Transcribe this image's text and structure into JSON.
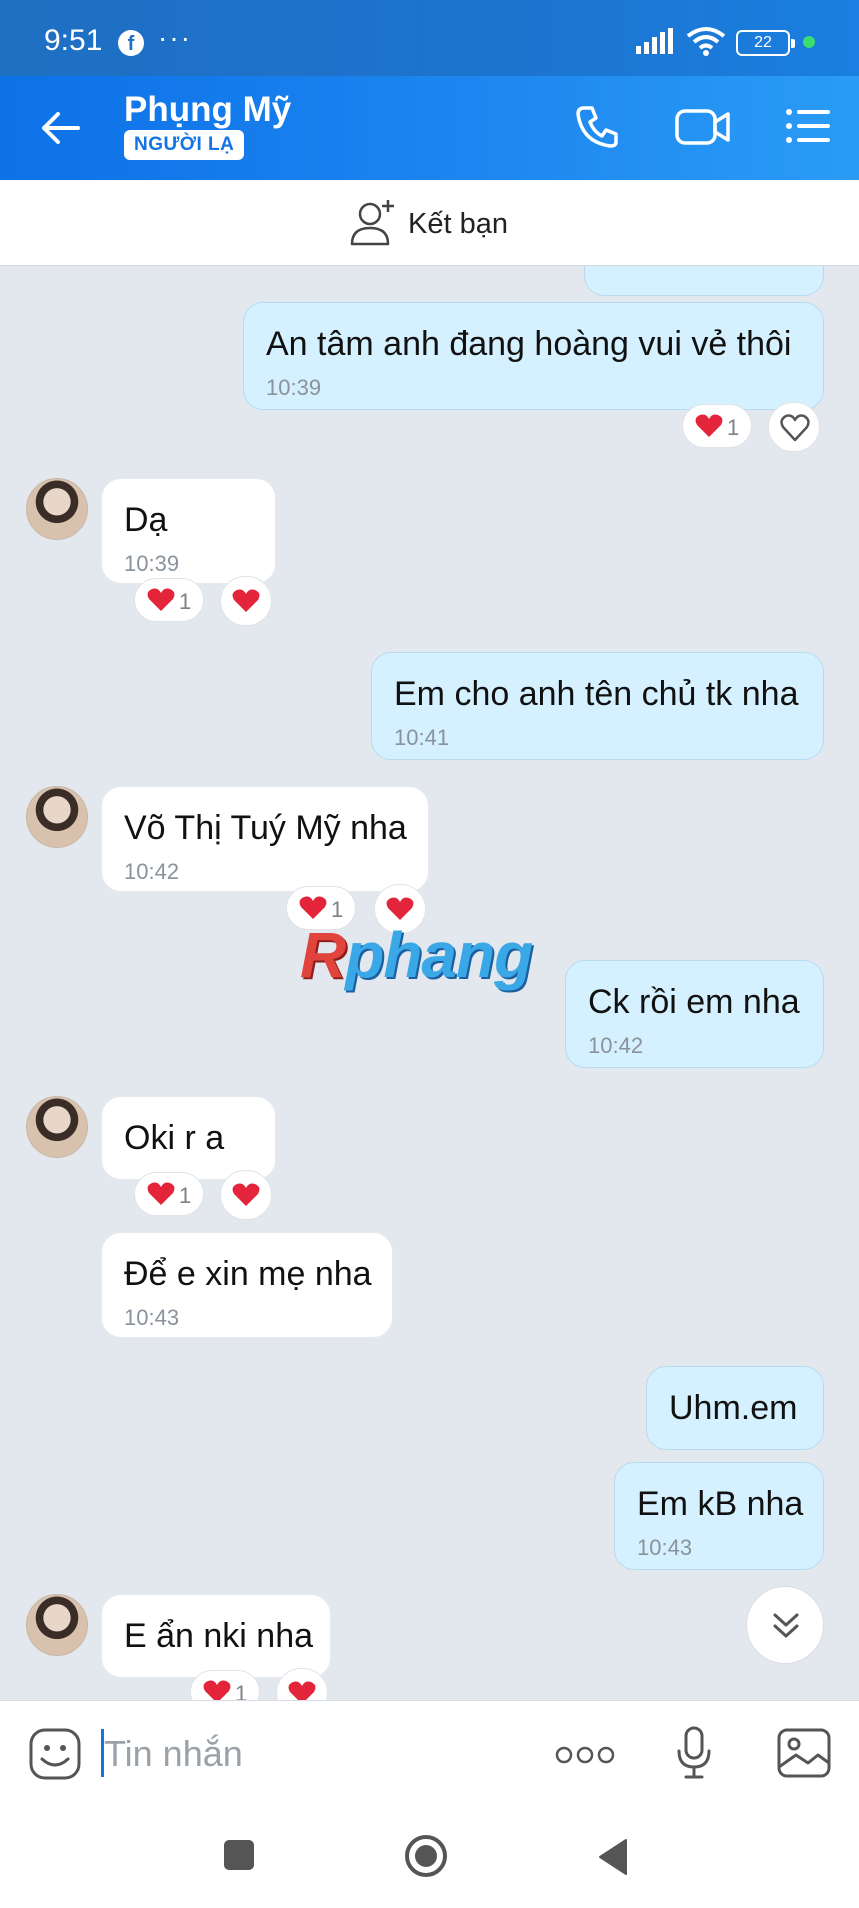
{
  "status_bar": {
    "time": "9:51",
    "notification_dots": "···",
    "battery": "22"
  },
  "header": {
    "contact_name": "Phụng Mỹ",
    "stranger_badge": "NGƯỜI LẠ"
  },
  "add_friend": {
    "label": "Kết bạn"
  },
  "messages": [
    {
      "dir": "out",
      "text": "An tâm anh đang hoàng vui vẻ thôi",
      "time": "10:39"
    },
    {
      "dir": "in",
      "text": "Dạ",
      "time": "10:39"
    },
    {
      "dir": "out",
      "text": "Em cho anh tên chủ tk nha",
      "time": "10:41"
    },
    {
      "dir": "in",
      "text": "Võ Thị Tuý Mỹ nha",
      "time": "10:42"
    },
    {
      "dir": "out",
      "text": "Ck rồi em nha",
      "time": "10:42"
    },
    {
      "dir": "in",
      "text": "Oki r a",
      "time": ""
    },
    {
      "dir": "in",
      "text": "Để e xin mẹ nha",
      "time": "10:43"
    },
    {
      "dir": "out",
      "text": "Uhm.em",
      "time": ""
    },
    {
      "dir": "out",
      "text": "Em kB nha",
      "time": "10:43"
    },
    {
      "dir": "in",
      "text": "E ẩn nki nha",
      "time": ""
    }
  ],
  "reaction_count": "1",
  "watermark": {
    "first": "R",
    "rest": "phang"
  },
  "composer": {
    "placeholder": "Tin nhắn"
  },
  "colors": {
    "header_blue": "#1d86f0",
    "outgoing_bubble": "#d5f1ff",
    "incoming_bubble": "#ffffff",
    "heart": "#e3243b"
  }
}
